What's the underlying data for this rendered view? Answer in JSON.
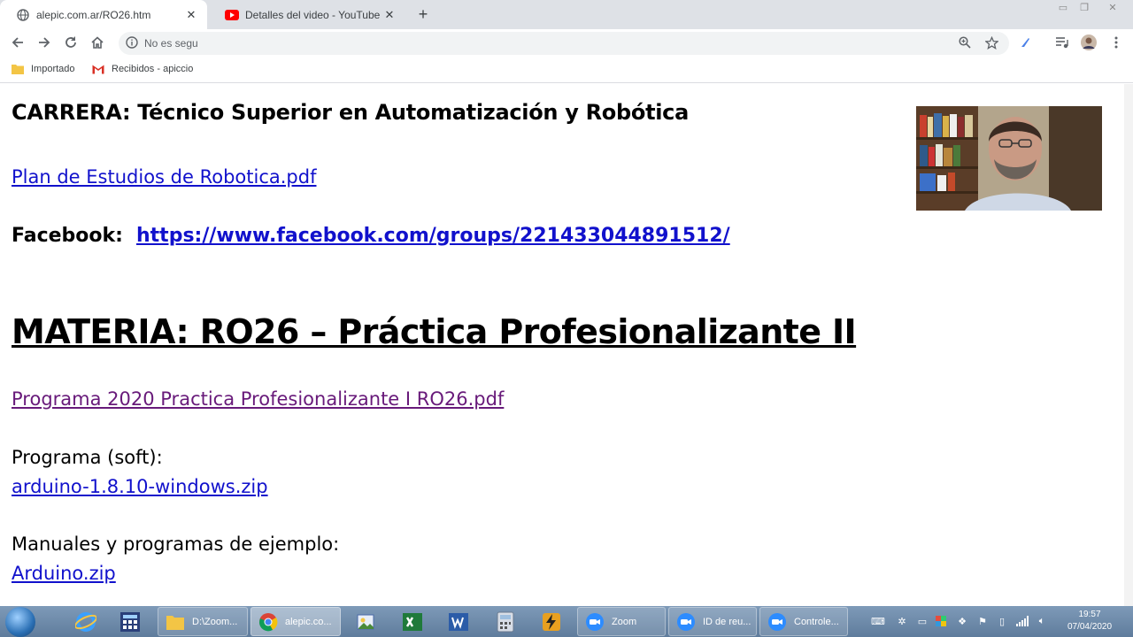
{
  "browser": {
    "tabs": [
      {
        "title": "alepic.com.ar/RO26.htm",
        "favicon": "globe-icon",
        "active": true
      },
      {
        "title": "Detalles del video - YouTube Studio",
        "favicon": "youtube-icon",
        "active": false
      }
    ],
    "toolbar": {
      "security_text": "No es seguro",
      "icons": [
        "back-icon",
        "forward-icon",
        "reload-icon",
        "home-icon",
        "zoom-icon",
        "star-icon",
        "extension-icon",
        "media-icon",
        "profile-icon",
        "menu-icon"
      ]
    },
    "bookmarks": [
      {
        "label": "Importado",
        "icon": "folder-icon"
      },
      {
        "label": "Recibidos - apiccio",
        "icon": "gmail-icon"
      }
    ]
  },
  "page": {
    "career_title": "CARRERA: Técnico Superior en Automatización y Robótica",
    "plan_link": "Plan de Estudios de Robotica.pdf",
    "facebook_label": "Facebook:",
    "facebook_link": "https://www.facebook.com/groups/221433044891512/",
    "subject_title": "MATERIA: RO26 – Práctica Profesionalizante II",
    "programa_link": "Programa 2020 Practica Profesionalizante I  RO26.pdf",
    "soft_label": "Programa (soft):",
    "arduino_link": "arduino-1.8.10-windows.zip",
    "manuals_label": "Manuales y programas de ejemplo:",
    "arduino_zip_link": "Arduino.zip"
  },
  "taskbar": {
    "items": [
      {
        "label": "D:\\Zoom...",
        "icon": "folder-icon"
      },
      {
        "label": "alepic.co...",
        "icon": "chrome-icon"
      },
      {
        "label": "Zoom",
        "icon": "zoom-app-icon"
      },
      {
        "label": "ID de reu...",
        "icon": "zoom-app-icon"
      },
      {
        "label": "Controle...",
        "icon": "zoom-app-icon"
      }
    ],
    "time": "19:57",
    "date": "07/04/2020"
  },
  "colors": {
    "link": "#1111cc",
    "visited": "#681a7a",
    "tabstrip": "#dee1e6"
  }
}
